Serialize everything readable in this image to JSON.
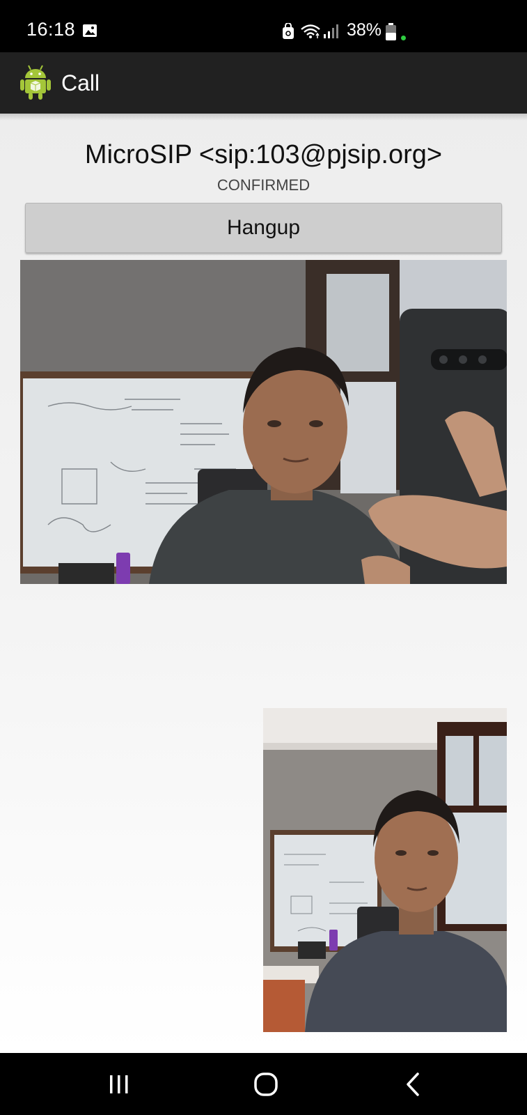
{
  "status_bar": {
    "time": "16:18",
    "battery_percent": "38%",
    "icons": [
      "gallery-icon",
      "vpn-icon",
      "wifi-icon",
      "signal-icon",
      "battery-icon"
    ]
  },
  "action_bar": {
    "title": "Call",
    "app_icon": "android-robot-icon"
  },
  "call": {
    "remote_uri": "MicroSIP <sip:103@pjsip.org>",
    "state": "CONFIRMED",
    "hangup_label": "Hangup"
  },
  "colors": {
    "action_bar": "#212121",
    "content_bg": "#f0f0f0",
    "button_bg": "#cecece",
    "status_dot": "#2ecc40",
    "android_green": "#a4c639"
  },
  "nav_bar": {
    "buttons": [
      "recent-apps-icon",
      "home-icon",
      "back-icon"
    ]
  }
}
